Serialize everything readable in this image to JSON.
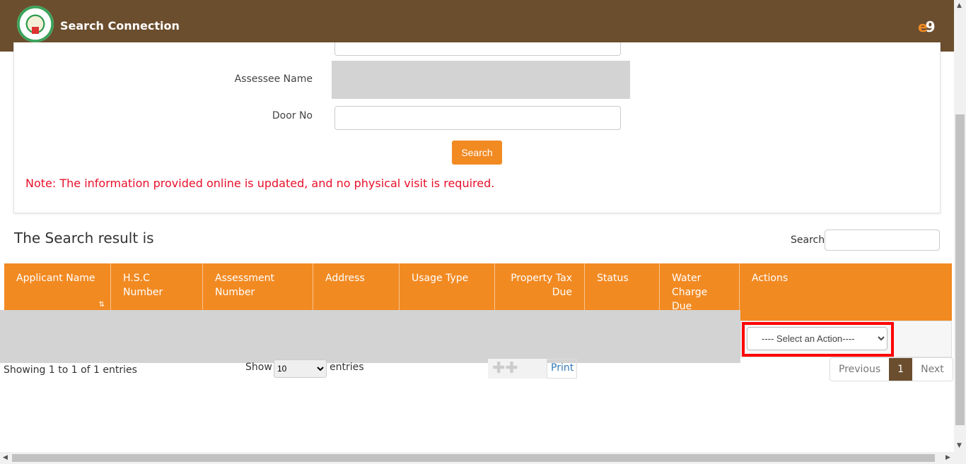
{
  "header": {
    "title": "Search Connection",
    "brand_logo": "eg"
  },
  "form": {
    "assessee_label": "Assessee Name",
    "door_label": "Door No",
    "door_value": "",
    "search_button": "Search",
    "note": "Note: The information provided online is updated, and no physical visit is required."
  },
  "results": {
    "heading": "The Search result is",
    "search_label": "Search",
    "search_value": "",
    "columns": [
      "Applicant Name",
      "H.S.C Number",
      "Assessment Number",
      "Address",
      "Usage Type",
      "Property Tax Due",
      "Status",
      "Water Charge Due",
      "Actions"
    ],
    "action_select": "---- Select an Action----",
    "info": "Showing 1 to 1 of 1 entries",
    "show_label": "Show",
    "page_length": "10",
    "entries_label": "entries",
    "print": "Print",
    "pagination": {
      "previous": "Previous",
      "current": "1",
      "next": "Next"
    }
  },
  "colors": {
    "header": "#6b4e2e",
    "accent": "#f28a22",
    "note": "#e8102a",
    "highlight": "#ff0000"
  }
}
